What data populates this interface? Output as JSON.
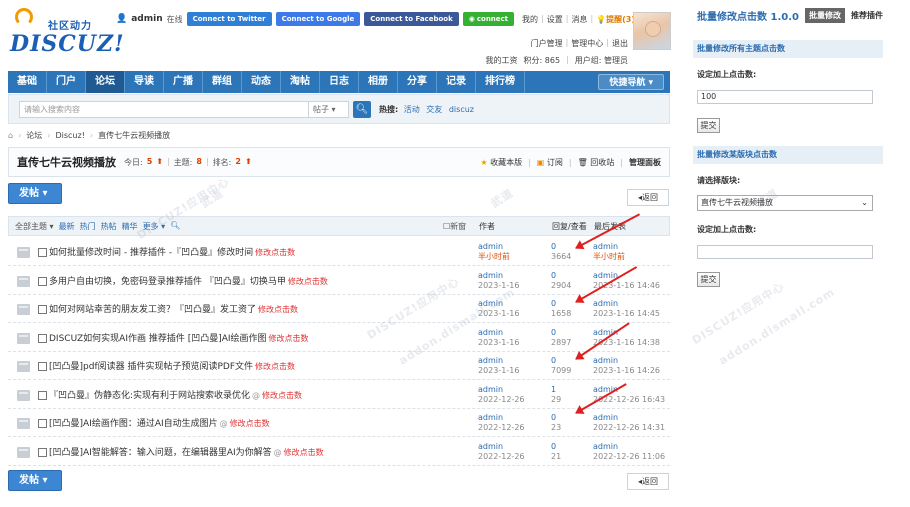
{
  "brand": {
    "slogan": "社区动力",
    "wordmark": "DISCUZ!"
  },
  "userbar": {
    "username": "admin",
    "online_status": "在线",
    "connect_twitter": "Connect to Twitter",
    "connect_google": "Connect to Google",
    "connect_facebook": "Connect to Facebook",
    "connect_wechat": "connect",
    "links": [
      "我的",
      "设置",
      "消息"
    ],
    "reminder": "提醒(3)",
    "links2": [
      "门户管理",
      "管理中心",
      "退出"
    ],
    "credits": [
      "我的工资",
      "积分: 865",
      "用户组: 管理员"
    ]
  },
  "nav": {
    "items": [
      "基础",
      "门户",
      "论坛",
      "导读",
      "广播",
      "群组",
      "动态",
      "淘帖",
      "日志",
      "相册",
      "分享",
      "记录",
      "排行榜"
    ],
    "active_index": 2,
    "quick_nav": "快捷导航"
  },
  "search": {
    "placeholder": "请输入搜索内容",
    "type": "帖子",
    "hot_label": "热搜:",
    "hot_terms": [
      "活动",
      "交友",
      "discuz"
    ]
  },
  "breadcrumb": [
    "论坛",
    "Discuz!",
    "直传七牛云视频播放"
  ],
  "forum": {
    "name": "直传七牛云视频播放",
    "today_label": "今日:",
    "today": "5",
    "topics_label": "主题:",
    "topics": "8",
    "rank_label": "排名:",
    "rank": "2",
    "favorite": "收藏本版",
    "subscribe": "订阅",
    "recycle": "回收站",
    "manage": "管理面板"
  },
  "buttons": {
    "post": "发帖",
    "back": "返回"
  },
  "thead": {
    "filters": [
      "全部主题",
      "最新",
      "热门",
      "热帖",
      "精华",
      "更多"
    ],
    "new_window": "新窗",
    "author": "作者",
    "replies_views": "回复/查看",
    "last_post": "最后发表"
  },
  "threads": [
    {
      "title": "如何批量修改时间 - 推荐插件 -『凹凸曼』修改时间",
      "edit": "修改点击数",
      "at": "",
      "author": "admin",
      "date": "半小时前",
      "date_hot": true,
      "replies": "0",
      "views": "3664",
      "last_user": "admin",
      "last_time": "半小时前",
      "last_hot": true
    },
    {
      "title": "多用户自由切换，免密码登录推荐插件 『凹凸曼』切换马甲",
      "edit": "修改点击数",
      "at": "",
      "author": "admin",
      "date": "2023-1-16",
      "date_hot": false,
      "replies": "0",
      "views": "2904",
      "last_user": "admin",
      "last_time": "2023-1-16 14:46",
      "last_hot": false
    },
    {
      "title": "如何对网站幸苦的朋友发工资？『凹凸曼』发工资了",
      "edit": "修改点击数",
      "at": "",
      "author": "admin",
      "date": "2023-1-16",
      "date_hot": false,
      "replies": "0",
      "views": "1658",
      "last_user": "admin",
      "last_time": "2023-1-16 14:45",
      "last_hot": false
    },
    {
      "title": "DISCUZ如何实现AI作画 推荐插件 [凹凸曼]AI绘画作图",
      "edit": "修改点击数",
      "at": "",
      "author": "admin",
      "date": "2023-1-16",
      "date_hot": false,
      "replies": "0",
      "views": "2897",
      "last_user": "admin",
      "last_time": "2023-1-16 14:38",
      "last_hot": false
    },
    {
      "title": "[凹凸曼]pdf阅读器 插件实现帖子预览阅读PDF文件",
      "edit": "修改点击数",
      "at": "",
      "author": "admin",
      "date": "2023-1-16",
      "date_hot": false,
      "replies": "0",
      "views": "7099",
      "last_user": "admin",
      "last_time": "2023-1-16 14:26",
      "last_hot": false
    },
    {
      "title": "『凹凸曼』伪静态化:实现有利于网站搜索收录优化",
      "edit": "修改点击数",
      "at": "@",
      "author": "admin",
      "date": "2022-12-26",
      "date_hot": false,
      "replies": "1",
      "views": "29",
      "last_user": "admin",
      "last_time": "2022-12-26 16:43",
      "last_hot": false
    },
    {
      "title": "[凹凸曼]AI绘画作图：通过AI自动生成图片",
      "edit": "修改点击数",
      "at": "@",
      "author": "admin",
      "date": "2022-12-26",
      "date_hot": false,
      "replies": "0",
      "views": "23",
      "last_user": "admin",
      "last_time": "2022-12-26 14:31",
      "last_hot": false
    },
    {
      "title": "[凹凸曼]AI智能解答：输入问题，在编辑器里AI为你解答",
      "edit": "修改点击数",
      "at": "@",
      "author": "admin",
      "date": "2022-12-26",
      "date_hot": false,
      "replies": "0",
      "views": "21",
      "last_user": "admin",
      "last_time": "2022-12-26 11:06",
      "last_hot": false
    }
  ],
  "watermark": [
    "DISCUZ!应用中心",
    "addon.dismall.com",
    "武道"
  ],
  "panel": {
    "title": "批量修改点击数 1.0.0",
    "tag": "批量修改",
    "recommend": "推荐插件",
    "section1": "批量修改所有主题点击数",
    "label1": "设定加上点击数:",
    "value1": "100",
    "submit1": "提交",
    "section2": "批量修改某版块点击数",
    "label2": "请选择版块:",
    "select_value": "直传七牛云视频播放",
    "label3": "设定加上点击数:",
    "value3": "",
    "submit2": "提交"
  },
  "colors": {
    "brand_blue": "#2b75b8",
    "link_blue": "#2b6cb0",
    "edit_red": "#e03030",
    "arrow_red": "#e02020",
    "logo_orange": "#f29b00"
  }
}
